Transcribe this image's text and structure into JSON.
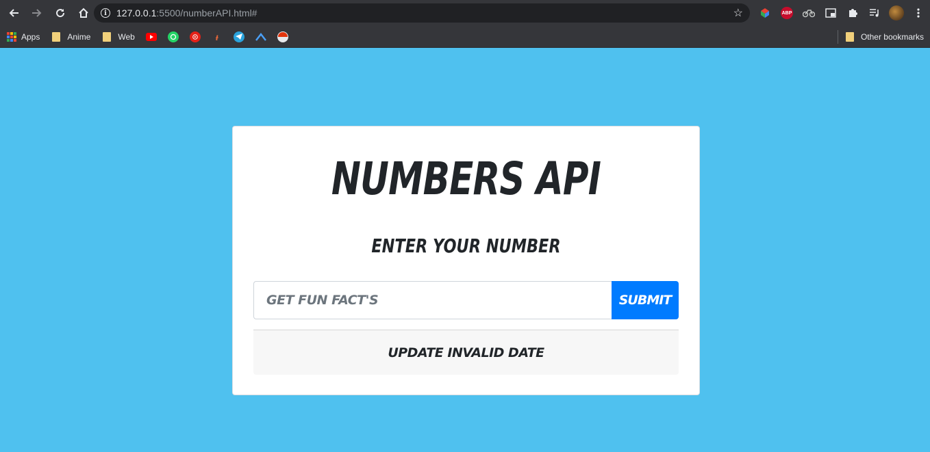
{
  "browser": {
    "url_host": "127.0.0.1",
    "url_path": ":5500/numberAPI.html#",
    "bookmarks": [
      {
        "label": "Apps"
      },
      {
        "label": "Anime"
      },
      {
        "label": "Web"
      }
    ],
    "other_bookmarks": "Other bookmarks",
    "extensions": [
      "colorful-extension-icon",
      "adblock-plus-icon",
      "bike-extension-icon",
      "picture-in-picture-icon",
      "puzzle-extensions-icon",
      "media-playlist-icon",
      "profile-avatar-icon"
    ],
    "abp_label": "ABP"
  },
  "page": {
    "title": "Numbers API",
    "subtitle": "Enter Your Number",
    "input_placeholder": "Get Fun Fact's",
    "input_value": "",
    "submit_label": "Submit",
    "output_text": "Update Invalid Date"
  },
  "colors": {
    "background": "#4fc1ef",
    "accent": "#007bff"
  }
}
